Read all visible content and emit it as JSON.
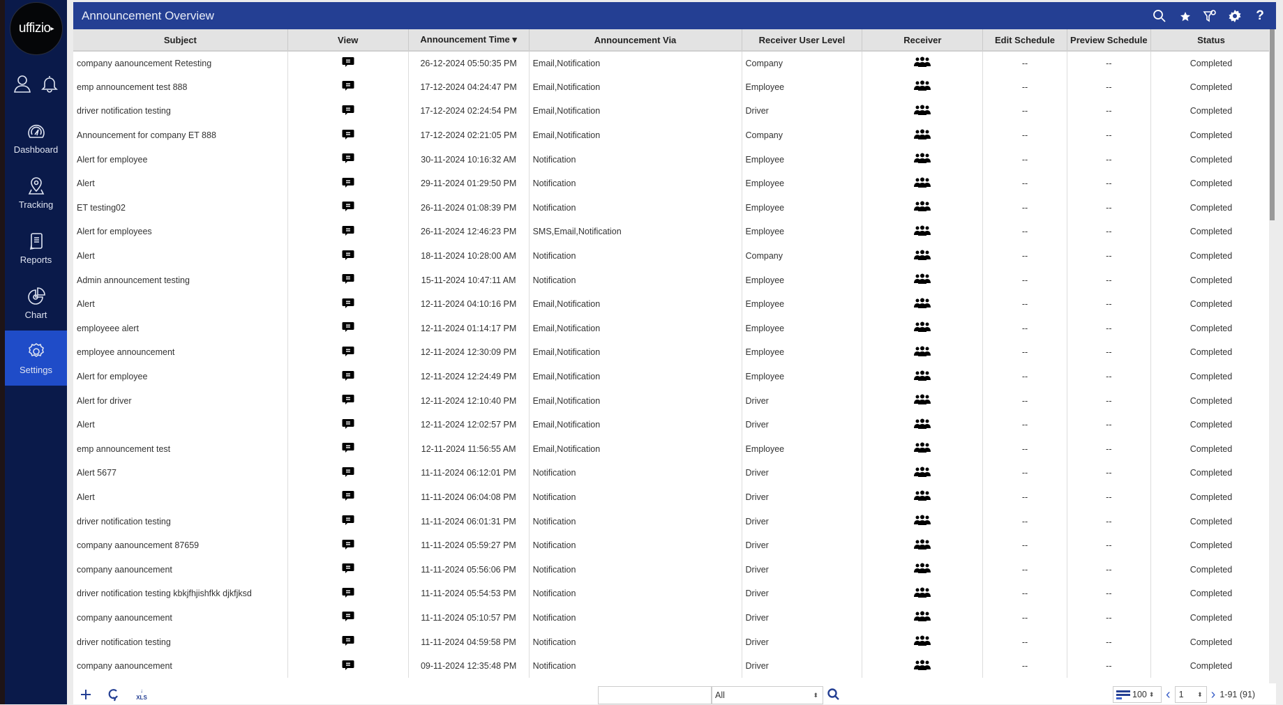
{
  "app": {
    "logo_text": "uffizio",
    "title": "Announcement Overview"
  },
  "sidebar": {
    "items": [
      {
        "label": "Dashboard",
        "icon": "gauge-icon"
      },
      {
        "label": "Tracking",
        "icon": "location-pin-icon"
      },
      {
        "label": "Reports",
        "icon": "document-icon"
      },
      {
        "label": "Chart",
        "icon": "pie-chart-icon"
      },
      {
        "label": "Settings",
        "icon": "gear-icon",
        "active": true
      }
    ]
  },
  "toolbar": {
    "icons": [
      "search-icon",
      "favorite-star-icon",
      "filter-settings-icon",
      "gear-icon",
      "help-icon"
    ],
    "help_label": "?"
  },
  "table": {
    "columns": [
      "Subject",
      "View",
      "Announcement Time ▾",
      "Announcement Via",
      "Receiver User Level",
      "Receiver",
      "Edit Schedule",
      "Preview Schedule",
      "Status"
    ],
    "rows": [
      {
        "subject": "company aanouncement Retesting",
        "time": "26-12-2024 05:50:35 PM",
        "via": "Email,Notification",
        "level": "Company",
        "edit": "--",
        "preview": "--",
        "status": "Completed"
      },
      {
        "subject": "emp announcement test 888",
        "time": "17-12-2024 04:24:47 PM",
        "via": "Email,Notification",
        "level": "Employee",
        "edit": "--",
        "preview": "--",
        "status": "Completed"
      },
      {
        "subject": "driver notification testing",
        "time": "17-12-2024 02:24:54 PM",
        "via": "Email,Notification",
        "level": "Driver",
        "edit": "--",
        "preview": "--",
        "status": "Completed"
      },
      {
        "subject": "Announcement for company ET 888",
        "time": "17-12-2024 02:21:05 PM",
        "via": "Email,Notification",
        "level": "Company",
        "edit": "--",
        "preview": "--",
        "status": "Completed"
      },
      {
        "subject": "Alert for employee",
        "time": "30-11-2024 10:16:32 AM",
        "via": "Notification",
        "level": "Employee",
        "edit": "--",
        "preview": "--",
        "status": "Completed"
      },
      {
        "subject": "Alert",
        "time": "29-11-2024 01:29:50 PM",
        "via": "Notification",
        "level": "Employee",
        "edit": "--",
        "preview": "--",
        "status": "Completed"
      },
      {
        "subject": "ET testing02",
        "time": "26-11-2024 01:08:39 PM",
        "via": "Notification",
        "level": "Employee",
        "edit": "--",
        "preview": "--",
        "status": "Completed"
      },
      {
        "subject": "Alert for employees",
        "time": "26-11-2024 12:46:23 PM",
        "via": "SMS,Email,Notification",
        "level": "Employee",
        "edit": "--",
        "preview": "--",
        "status": "Completed"
      },
      {
        "subject": "Alert",
        "time": "18-11-2024 10:28:00 AM",
        "via": "Notification",
        "level": "Company",
        "edit": "--",
        "preview": "--",
        "status": "Completed"
      },
      {
        "subject": "Admin announcement testing",
        "time": "15-11-2024 10:47:11 AM",
        "via": "Notification",
        "level": "Employee",
        "edit": "--",
        "preview": "--",
        "status": "Completed"
      },
      {
        "subject": "Alert",
        "time": "12-11-2024 04:10:16 PM",
        "via": "Email,Notification",
        "level": "Employee",
        "edit": "--",
        "preview": "--",
        "status": "Completed"
      },
      {
        "subject": "employeee alert",
        "time": "12-11-2024 01:14:17 PM",
        "via": "Email,Notification",
        "level": "Employee",
        "edit": "--",
        "preview": "--",
        "status": "Completed"
      },
      {
        "subject": "employee announcement",
        "time": "12-11-2024 12:30:09 PM",
        "via": "Email,Notification",
        "level": "Employee",
        "edit": "--",
        "preview": "--",
        "status": "Completed"
      },
      {
        "subject": "Alert for employee",
        "time": "12-11-2024 12:24:49 PM",
        "via": "Email,Notification",
        "level": "Employee",
        "edit": "--",
        "preview": "--",
        "status": "Completed"
      },
      {
        "subject": "Alert for driver",
        "time": "12-11-2024 12:10:40 PM",
        "via": "Email,Notification",
        "level": "Driver",
        "edit": "--",
        "preview": "--",
        "status": "Completed"
      },
      {
        "subject": "Alert",
        "time": "12-11-2024 12:02:57 PM",
        "via": "Email,Notification",
        "level": "Driver",
        "edit": "--",
        "preview": "--",
        "status": "Completed"
      },
      {
        "subject": "emp announcement test",
        "time": "12-11-2024 11:56:55 AM",
        "via": "Email,Notification",
        "level": "Employee",
        "edit": "--",
        "preview": "--",
        "status": "Completed"
      },
      {
        "subject": "Alert 5677",
        "time": "11-11-2024 06:12:01 PM",
        "via": "Notification",
        "level": "Driver",
        "edit": "--",
        "preview": "--",
        "status": "Completed"
      },
      {
        "subject": "Alert",
        "time": "11-11-2024 06:04:08 PM",
        "via": "Notification",
        "level": "Driver",
        "edit": "--",
        "preview": "--",
        "status": "Completed"
      },
      {
        "subject": "driver notification testing",
        "time": "11-11-2024 06:01:31 PM",
        "via": "Notification",
        "level": "Driver",
        "edit": "--",
        "preview": "--",
        "status": "Completed"
      },
      {
        "subject": "company aanouncement 87659",
        "time": "11-11-2024 05:59:27 PM",
        "via": "Notification",
        "level": "Driver",
        "edit": "--",
        "preview": "--",
        "status": "Completed"
      },
      {
        "subject": "company aanouncement",
        "time": "11-11-2024 05:56:06 PM",
        "via": "Notification",
        "level": "Driver",
        "edit": "--",
        "preview": "--",
        "status": "Completed"
      },
      {
        "subject": "driver notification testing kbkjfhjishfkk djkfjksd",
        "time": "11-11-2024 05:54:53 PM",
        "via": "Notification",
        "level": "Driver",
        "edit": "--",
        "preview": "--",
        "status": "Completed"
      },
      {
        "subject": "company aanouncement",
        "time": "11-11-2024 05:10:57 PM",
        "via": "Notification",
        "level": "Driver",
        "edit": "--",
        "preview": "--",
        "status": "Completed"
      },
      {
        "subject": "driver notification testing",
        "time": "11-11-2024 04:59:58 PM",
        "via": "Notification",
        "level": "Driver",
        "edit": "--",
        "preview": "--",
        "status": "Completed"
      },
      {
        "subject": "company aanouncement",
        "time": "09-11-2024 12:35:48 PM",
        "via": "Notification",
        "level": "Driver",
        "edit": "--",
        "preview": "--",
        "status": "Completed"
      }
    ]
  },
  "footer": {
    "search_value": "",
    "filter_selected": "All",
    "page_size": "100",
    "page_number": "1",
    "range_text": "1-91 (91)",
    "xls_label": "XLS"
  }
}
